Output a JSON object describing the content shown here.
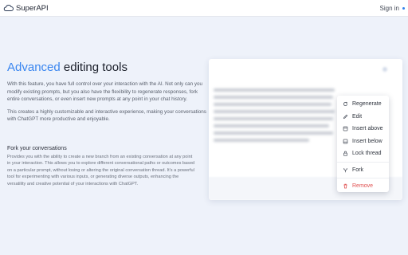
{
  "header": {
    "brand": "SuperAPI",
    "signin": "Sign in"
  },
  "main": {
    "headline_accent": "Advanced",
    "headline_rest": " editing tools",
    "paragraph1": "With this feature, you have full control over your interaction with the AI. Not only can you modify existing prompts, but you also have the flexibility to regenerate responses, fork entire conversations, or even insert new prompts at any point in your chat history.",
    "paragraph2": "This creates a highly customizable and interactive experience, making your conversations with ChatGPT more productive and enjoyable.",
    "fork_heading": "Fork your conversations",
    "fork_paragraph": "Provides you with the ability to create a new branch from an existing conversation at any point in your interaction. This allows you to explore different conversational paths or outcomes based on a particular prompt, without losing or altering the original conversation thread. It's a powerful tool for experimenting with various inputs, or generating diverse outputs, enhancing the versatility and creative potential of your interactions with ChatGPT."
  },
  "menu": {
    "items": [
      {
        "label": "Regenerate",
        "icon": "refresh-icon"
      },
      {
        "label": "Edit",
        "icon": "pencil-icon"
      },
      {
        "label": "Insert above",
        "icon": "insert-above-icon"
      },
      {
        "label": "Insert below",
        "icon": "insert-below-icon"
      },
      {
        "label": "Lock thread",
        "icon": "lock-icon"
      },
      {
        "label": "Fork",
        "icon": "fork-icon"
      },
      {
        "label": "Remove",
        "icon": "trash-icon"
      }
    ]
  },
  "colors": {
    "accent": "#3a86f0",
    "danger": "#e05050",
    "background": "#eef2fa"
  }
}
